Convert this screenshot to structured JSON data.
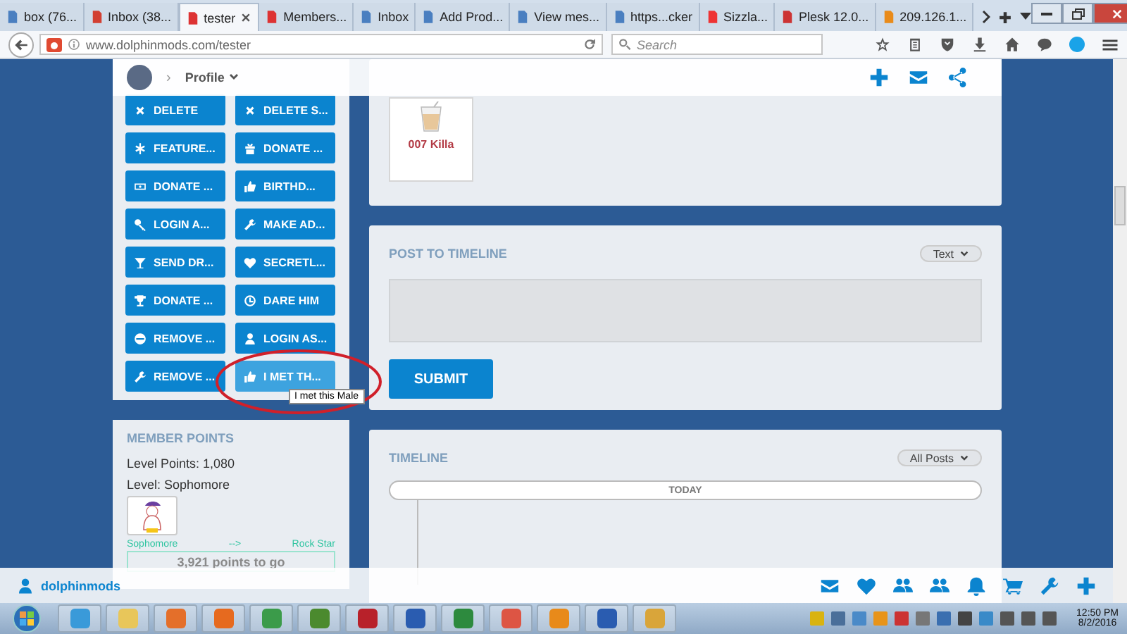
{
  "browser": {
    "tabs": [
      {
        "title": "box (76...",
        "selected": false
      },
      {
        "title": "Inbox (38...",
        "selected": false
      },
      {
        "title": "tester",
        "selected": true
      },
      {
        "title": "Members...",
        "selected": false
      },
      {
        "title": "Inbox",
        "selected": false
      },
      {
        "title": "Add Prod...",
        "selected": false
      },
      {
        "title": "View mes...",
        "selected": false
      },
      {
        "title": "https...cker",
        "selected": false
      },
      {
        "title": "Sizzla...",
        "selected": false
      },
      {
        "title": "Plesk 12.0...",
        "selected": false
      },
      {
        "title": "209.126.1...",
        "selected": false
      }
    ],
    "address": "www.dolphinmods.com/tester",
    "search": {
      "placeholder": "Search"
    }
  },
  "header": {
    "separator": "›",
    "title": "Profile"
  },
  "actions": [
    {
      "label": "DELETE",
      "hovered": false
    },
    {
      "label": "DELETE S...",
      "hovered": false
    },
    {
      "label": "FEATURE...",
      "hovered": false
    },
    {
      "label": "DONATE ...",
      "hovered": false
    },
    {
      "label": "DONATE ...",
      "hovered": false
    },
    {
      "label": "BIRTHD...",
      "hovered": false
    },
    {
      "label": "LOGIN A...",
      "hovered": false
    },
    {
      "label": "MAKE AD...",
      "hovered": false
    },
    {
      "label": "SEND DR...",
      "hovered": false
    },
    {
      "label": "SECRETL...",
      "hovered": false
    },
    {
      "label": "DONATE ...",
      "hovered": false
    },
    {
      "label": "DARE HIM",
      "hovered": false
    },
    {
      "label": "REMOVE ...",
      "hovered": false
    },
    {
      "label": "LOGIN AS...",
      "hovered": false
    },
    {
      "label": "REMOVE ...",
      "hovered": false
    },
    {
      "label": "I MET TH...",
      "hovered": true
    }
  ],
  "tooltip": "I met this Male",
  "member_points": {
    "title": "MEMBER POINTS",
    "level_points": "Level Points: 1,080",
    "level_name": "Level: Sophomore",
    "current_rank": "Sophomore",
    "arrow": "-->",
    "next_rank": "Rock Star",
    "progress": {
      "label": "3,921 points to go",
      "level": 0
    }
  },
  "gift": {
    "name": "007 Killa"
  },
  "post": {
    "title": "POST TO TIMELINE",
    "type": "Text",
    "submit": "SUBMIT"
  },
  "timeline": {
    "title": "TIMELINE",
    "filter": "All Posts",
    "date_marker": "TODAY"
  },
  "site_bar": {
    "username": "dolphinmods"
  },
  "taskbar": {
    "time": "12:50 PM",
    "date": "8/2/2016"
  }
}
